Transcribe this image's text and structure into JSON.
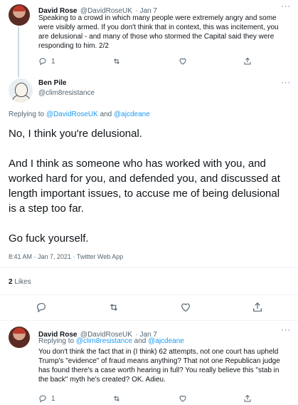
{
  "tweet1": {
    "name": "David Rose",
    "handle": "@DavidRoseUK",
    "time": "· Jan 7",
    "text": "Speaking to a crowd in which many people were extremely angry and some were visibly armed. If you don't think that in context, this was incitement, you are delusional - and many of those who stormed the Capital said they were responding to him. 2/2",
    "replies": "1"
  },
  "main": {
    "name": "Ben Pile",
    "handle": "@clim8resistance",
    "replying_prefix": "Replying to",
    "replying_to_1": "@DavidRoseUK",
    "replying_and": "and",
    "replying_to_2": "@ajcdeane",
    "para1": "No, I think you're delusional.",
    "para2": "And I think as someone who has worked with you, and worked hard for you, and defended you, and discussed at length important issues, to accuse me of being delusional is a step too far.",
    "para3": "Go fuck yourself.",
    "timestamp": "8:41 AM · Jan 7, 2021 · Twitter Web App",
    "likes_count": "2",
    "likes_label": "Likes"
  },
  "tweet3": {
    "name": "David Rose",
    "handle": "@DavidRoseUK",
    "time": "· Jan 7",
    "replying_prefix": "Replying to",
    "replying_to_1": "@clim8resistance",
    "replying_and": "and",
    "replying_to_2": "@ajcdeane",
    "text": "You don't think the fact that in (I think) 62 attempts, not one court has upheld Trump's \"evidence\" of fraud means anything? That not one Republican judge has found there's a case worth hearing in full? You really believe this \"stab in the back\" myth he's created? OK. Adieu.",
    "replies": "1"
  },
  "icons": {
    "reply": "reply-icon",
    "retweet": "retweet-icon",
    "like": "heart-icon",
    "share": "share-icon",
    "more": "more-icon"
  },
  "more_glyph": "···"
}
